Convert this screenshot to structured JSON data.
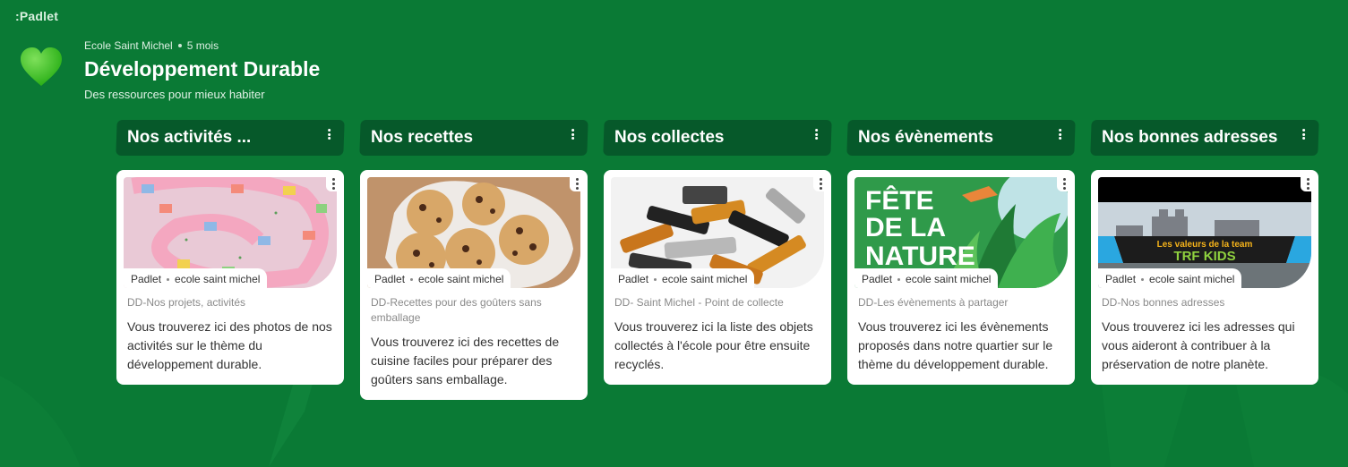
{
  "logo": ":Padlet",
  "header": {
    "author": "Ecole Saint Michel",
    "age": "5 mois",
    "title": "Développement Durable",
    "subtitle": "Des ressources pour mieux habiter"
  },
  "columns": [
    {
      "title": "Nos activités ...",
      "card": {
        "source": "Padlet",
        "source_owner": "ecole saint michel",
        "subtitle": "DD-Nos projets, activités",
        "description": "Vous trouverez ici des photos de nos activités sur le thème du développement durable."
      }
    },
    {
      "title": "Nos recettes",
      "card": {
        "source": "Padlet",
        "source_owner": "ecole saint michel",
        "subtitle": "DD-Recettes pour des goûters sans emballage",
        "description": "Vous trouverez ici des recettes de cuisine faciles pour préparer des goûters sans emballage."
      }
    },
    {
      "title": "Nos collectes",
      "card": {
        "source": "Padlet",
        "source_owner": "ecole saint michel",
        "subtitle": "DD- Saint Michel - Point de collecte",
        "description": "Vous trouverez ici la liste des objets collectés à l'école pour être ensuite recyclés."
      }
    },
    {
      "title": "Nos évènements",
      "card": {
        "source": "Padlet",
        "source_owner": "ecole saint michel",
        "subtitle": "DD-Les évènements à partager",
        "description": "Vous trouverez ici les évènements proposés dans notre quartier sur le thème du développement durable.",
        "image_text": [
          "FÊTE",
          "DE LA",
          "NATURE"
        ]
      }
    },
    {
      "title": "Nos bonnes adresses",
      "card": {
        "source": "Padlet",
        "source_owner": "ecole saint michel",
        "subtitle": "DD-Nos bonnes adresses",
        "description": "Vous trouverez ici les adresses qui vous aideront à contribuer à la préservation de notre planète.",
        "image_text": [
          "Les valeurs de la team",
          "TRF KIDS"
        ]
      }
    }
  ],
  "colors": {
    "background": "#0a7a35",
    "column_header": "#06592a",
    "heart": "#38c71d"
  }
}
